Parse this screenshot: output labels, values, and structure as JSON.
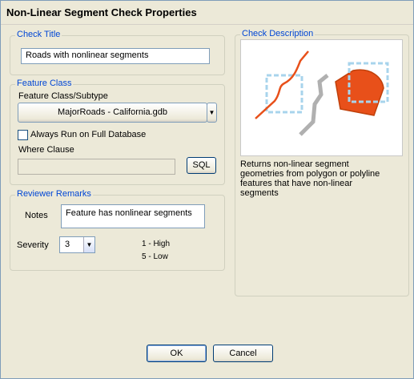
{
  "window": {
    "title": "Non-Linear Segment Check Properties"
  },
  "check_title": {
    "group_label": "Check Title",
    "value": "Roads with nonlinear segments"
  },
  "feature_class": {
    "group_label": "Feature Class",
    "subtype_label": "Feature Class/Subtype",
    "selected": "MajorRoads -  California.gdb",
    "always_run_label": "Always Run on Full Database",
    "always_run_checked": false,
    "where_clause_label": "Where Clause",
    "where_clause_value": "",
    "sql_button": "SQL"
  },
  "reviewer_remarks": {
    "group_label": "Reviewer Remarks",
    "notes_label": "Notes",
    "notes_value": "Feature has nonlinear segments",
    "severity_label": "Severity",
    "severity_value": "3",
    "severity_hint_high": "1 - High",
    "severity_hint_low": "5 - Low"
  },
  "check_description": {
    "group_label": "Check Description",
    "text": "Returns non-linear segment geometries from polygon or polyline features that have non-linear segments",
    "illustration_colors": {
      "orange": "#e8501a",
      "dash": "#a8d4ec",
      "gray": "#b0b0b0"
    }
  },
  "buttons": {
    "ok": "OK",
    "cancel": "Cancel"
  }
}
